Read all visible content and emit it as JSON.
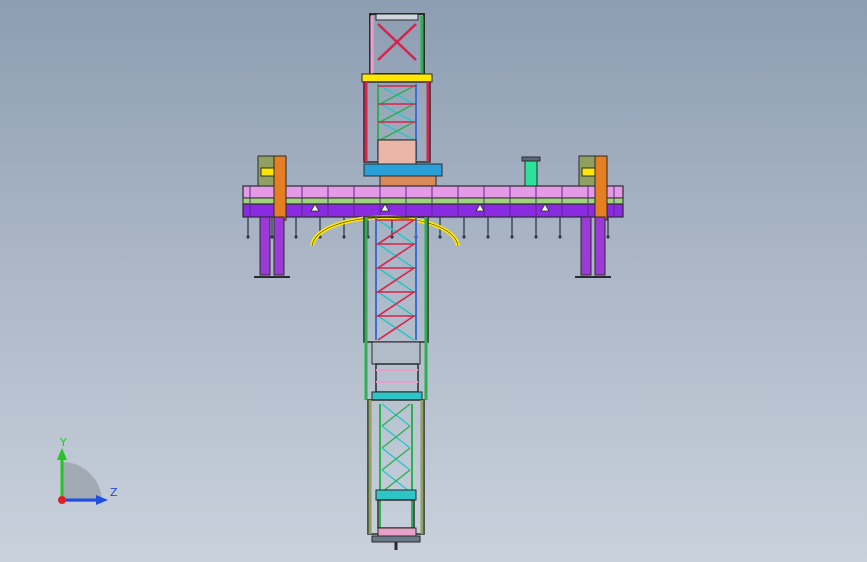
{
  "viewport": {
    "background_top": "#8d9db2",
    "background_bottom": "#c9d1dc"
  },
  "model": {
    "colors": {
      "edge": "#2b2b2b",
      "mast_red": "#d6244c",
      "mast_green": "#2fae52",
      "mast_blue": "#3b6fd0",
      "mast_cyan": "#2cc6c6",
      "mast_pink": "#e8a0c8",
      "beam_pink": "#e49ae6",
      "beam_purple": "#8a2be2",
      "beam_green": "#9fd47a",
      "leg_purple": "#9b3ad6",
      "arc_yellow": "#ffe600",
      "orange": "#e67e22",
      "teal_box": "#2ee09a",
      "blue_plate": "#2a9fd8",
      "olive": "#8fa060",
      "grey": "#7a8a9a"
    }
  },
  "triad": {
    "y_label": "Y",
    "z_label": "Z",
    "y_color": "#27c427",
    "z_color": "#1f4fe0",
    "x_color": "#e02020"
  }
}
